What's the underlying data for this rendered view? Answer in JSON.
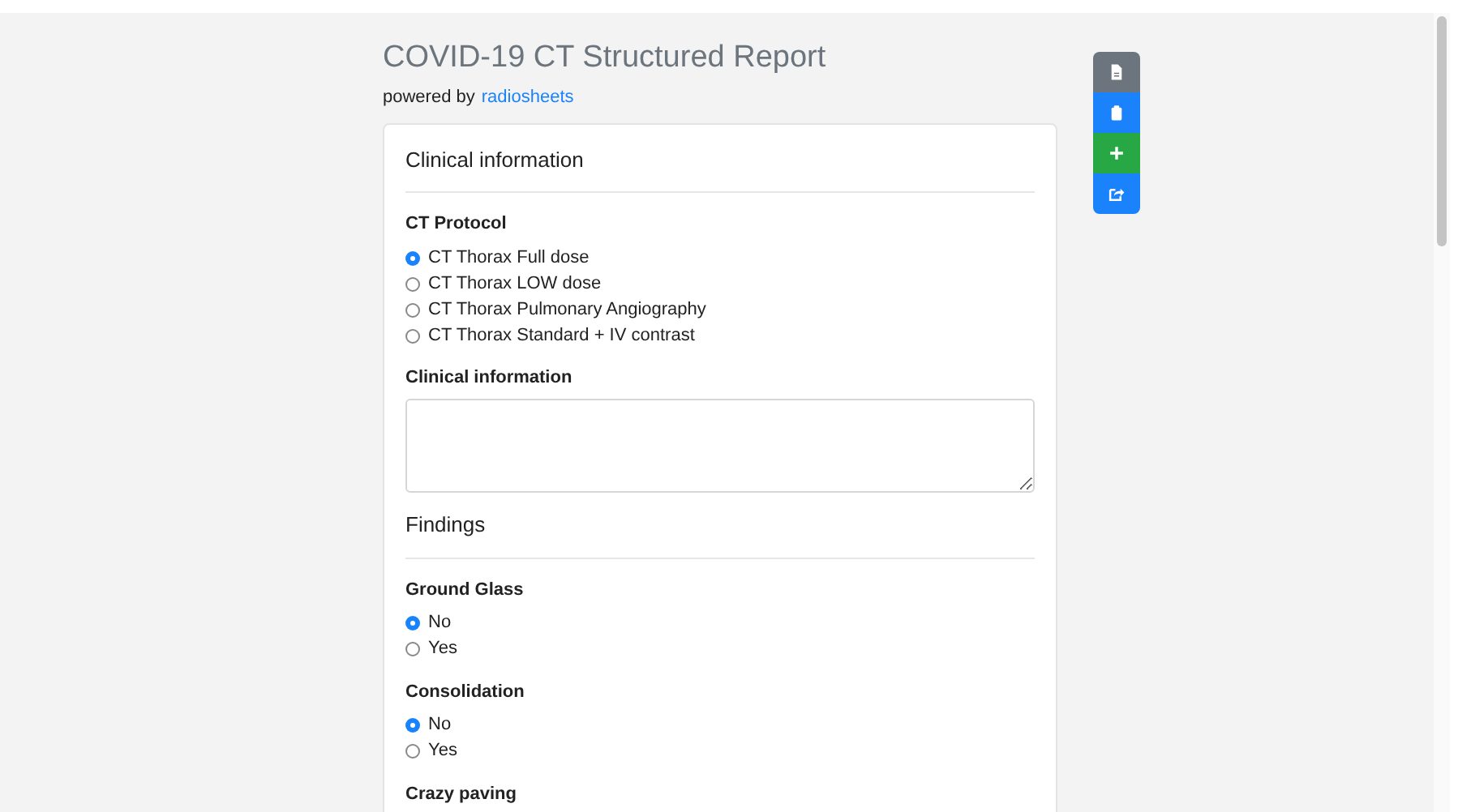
{
  "title": "COVID-19 CT Structured Report",
  "powered_by": {
    "prefix": "powered by",
    "link": "radiosheets"
  },
  "sections": [
    {
      "heading": "Clinical information",
      "fields": [
        {
          "kind": "radio",
          "label": "CT Protocol",
          "options": [
            {
              "label": "CT Thorax Full dose",
              "selected": true
            },
            {
              "label": "CT Thorax LOW dose",
              "selected": false
            },
            {
              "label": "CT Thorax Pulmonary Angiography",
              "selected": false
            },
            {
              "label": "CT Thorax Standard + IV contrast",
              "selected": false
            }
          ]
        },
        {
          "kind": "textarea",
          "label": "Clinical information"
        }
      ]
    },
    {
      "heading": "Findings",
      "fields": [
        {
          "kind": "radio",
          "label": "Ground Glass",
          "options": [
            {
              "label": "No",
              "selected": true
            },
            {
              "label": "Yes",
              "selected": false
            }
          ]
        },
        {
          "kind": "radio",
          "label": "Consolidation",
          "options": [
            {
              "label": "No",
              "selected": true
            },
            {
              "label": "Yes",
              "selected": false
            }
          ]
        },
        {
          "kind": "label",
          "label": "Crazy paving"
        }
      ]
    }
  ],
  "toolbar": [
    {
      "kind": "document",
      "color": "#6c757d"
    },
    {
      "kind": "clipboard",
      "color": "#1a82fb"
    },
    {
      "kind": "plus",
      "color": "#28a745"
    },
    {
      "kind": "share",
      "color": "#1a82fb"
    }
  ]
}
